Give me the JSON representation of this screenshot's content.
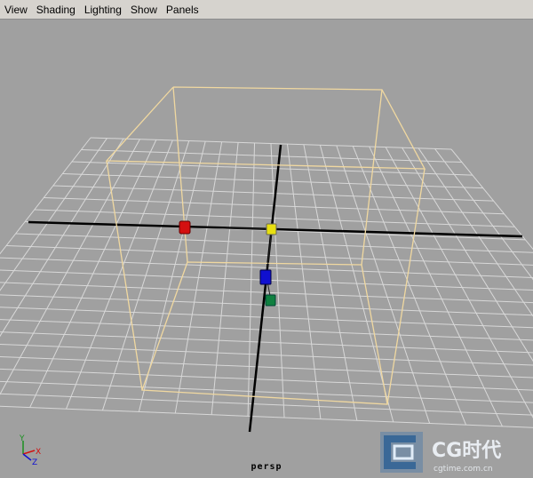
{
  "menubar": {
    "items": [
      {
        "label": "View"
      },
      {
        "label": "Shading"
      },
      {
        "label": "Lighting"
      },
      {
        "label": "Show"
      },
      {
        "label": "Panels"
      }
    ]
  },
  "viewport": {
    "camera_label": "persp",
    "background_color": "#a0a0a0",
    "grid_color": "#d8d8d8",
    "axis_color": "#000000",
    "bounding_box_color": "#f0d8a0",
    "manipulators": [
      {
        "name": "red-handle",
        "color": "#d41010"
      },
      {
        "name": "yellow-handle",
        "color": "#e8e010"
      },
      {
        "name": "blue-handle",
        "color": "#1010d0"
      },
      {
        "name": "green-handle",
        "color": "#108040"
      }
    ],
    "axis_gizmo": {
      "x_label": "X",
      "y_label": "Y",
      "z_label": "Z"
    }
  },
  "watermark": {
    "brand": "CG时代",
    "url": "cgtime.com.cn"
  }
}
